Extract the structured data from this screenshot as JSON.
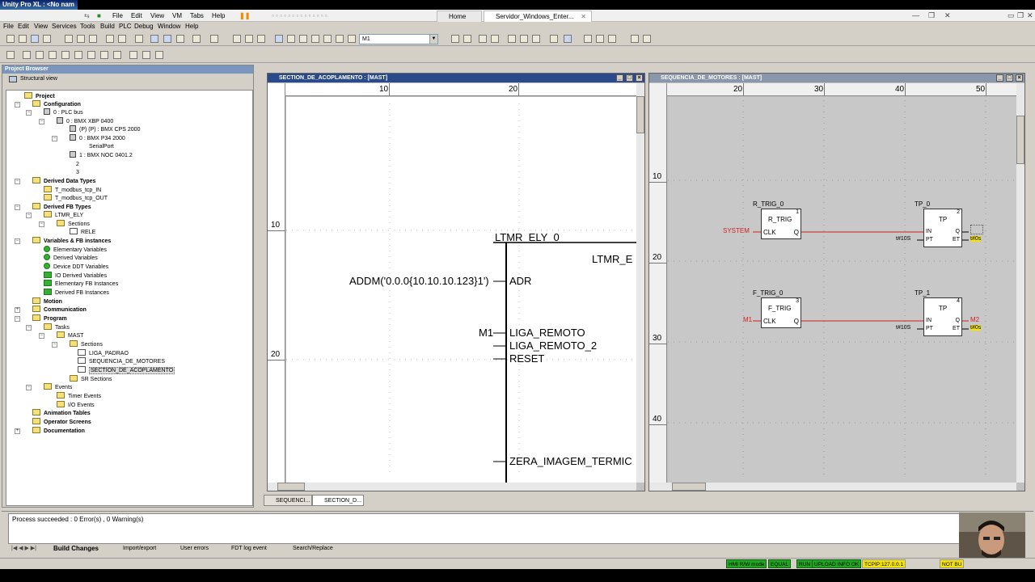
{
  "app": {
    "title": "Unity Pro XL : <No nam",
    "menu": [
      "File",
      "Edit",
      "View",
      "VM",
      "Tabs",
      "Help"
    ],
    "tabs": [
      {
        "label": "Home"
      },
      {
        "label": "Servidor_Windows_Enter..."
      }
    ]
  },
  "menubar": [
    "File",
    "Edit",
    "View",
    "Services",
    "Tools",
    "Build",
    "PLC",
    "Debug",
    "Window",
    "Help"
  ],
  "toolbar": {
    "combo_value": "M1"
  },
  "project_browser": {
    "title": "Project Browser",
    "view_label": "Structural view",
    "nodes": [
      {
        "label": "Project",
        "bold": true
      },
      {
        "label": "Configuration",
        "bold": true
      },
      {
        "label": "0 : PLC bus"
      },
      {
        "label": "0 : BMX XBP 0400"
      },
      {
        "label": "(P) (P) : BMX CPS 2000"
      },
      {
        "label": "0 : BMX P34 2000"
      },
      {
        "label": "SerialPort"
      },
      {
        "label": "1 : BMX NOC 0401.2"
      },
      {
        "label": "2"
      },
      {
        "label": "3"
      },
      {
        "label": "Derived Data Types",
        "bold": true
      },
      {
        "label": "T_modbus_tcp_IN"
      },
      {
        "label": "T_modbus_tcp_OUT"
      },
      {
        "label": "Derived FB Types",
        "bold": true
      },
      {
        "label": "LTMR_ELY"
      },
      {
        "label": "Sections"
      },
      {
        "label": "RELE"
      },
      {
        "label": "Variables & FB instances",
        "bold": true
      },
      {
        "label": "Elementary Variables"
      },
      {
        "label": "Derived Variables"
      },
      {
        "label": "Device DDT Variables"
      },
      {
        "label": "IO Derived Variables"
      },
      {
        "label": "Elementary FB Instances"
      },
      {
        "label": "Derived FB Instances"
      },
      {
        "label": "Motion",
        "bold": true
      },
      {
        "label": "Communication",
        "bold": true
      },
      {
        "label": "Program",
        "bold": true
      },
      {
        "label": "Tasks"
      },
      {
        "label": "MAST"
      },
      {
        "label": "Sections"
      },
      {
        "label": "LIGA_PADRAO"
      },
      {
        "label": "SEQUENCIA_DE_MOTORES"
      },
      {
        "label": "SECTION_DE_ACOPLAMENTO"
      },
      {
        "label": "SR Sections"
      },
      {
        "label": "Events"
      },
      {
        "label": "Timer Events"
      },
      {
        "label": "I/O Events"
      },
      {
        "label": "Animation Tables",
        "bold": true
      },
      {
        "label": "Operator Screens",
        "bold": true
      },
      {
        "label": "Documentation",
        "bold": true
      }
    ]
  },
  "window_left": {
    "title": "SECTION_DE_ACOPLAMENTO : [MAST]",
    "ruler_h": [
      "10",
      "20"
    ],
    "ruler_v": [
      "10",
      "20"
    ],
    "fb": {
      "instance": "LTMR_ELY_0",
      "type": "LTMR_E",
      "adr_arg": "ADDM('0.0.0{10.10.10.123}1')",
      "pins": [
        "ADR",
        "LIGA_REMOTO",
        "LIGA_REMOTO_2",
        "RESET",
        "ZERA_IMAGEM_TERMIC"
      ],
      "m1": "M1"
    }
  },
  "window_right": {
    "title": "SEQUENCIA_DE_MOTORES : [MAST]",
    "ruler_h": [
      "20",
      "30",
      "40",
      "50"
    ],
    "ruler_v": [
      "10",
      "20",
      "30",
      "40"
    ],
    "blocks": [
      {
        "instance": "R_TRIG_0",
        "type": "R_TRIG",
        "num": "1",
        "in": "CLK",
        "out": "Q",
        "input_var": "SYSTEM"
      },
      {
        "instance": "TP_0",
        "type": "TP",
        "num": "2",
        "in1": "IN",
        "in2": "PT",
        "out1": "Q",
        "out2": "ET",
        "pt": "t#10S",
        "et": "t#0s"
      },
      {
        "instance": "F_TRIG_0",
        "type": "F_TRIG",
        "num": "3",
        "in": "CLK",
        "out": "Q",
        "input_var": "M1"
      },
      {
        "instance": "TP_1",
        "type": "TP",
        "num": "4",
        "in1": "IN",
        "in2": "PT",
        "out1": "Q",
        "out2": "ET",
        "pt": "t#10S",
        "q_var": "M2",
        "et": "t#0s"
      }
    ]
  },
  "doc_tabs": [
    "SEQUENCI...",
    "SECTION_D..."
  ],
  "output": {
    "message": "Process succeeded : 0 Error(s) , 0 Warning(s)",
    "tabs": [
      "Build Changes",
      "Import/export",
      "User errors",
      "FDT log event",
      "Search/Replace"
    ]
  },
  "status": {
    "items": [
      "HMI R/W mode",
      "EQUAL",
      "RUN",
      "UPLOAD INFO OK",
      "TCPIP:127.0.0.1",
      "NOT BU"
    ],
    "green": "#1fa61f",
    "yellow": "#f4e400"
  }
}
